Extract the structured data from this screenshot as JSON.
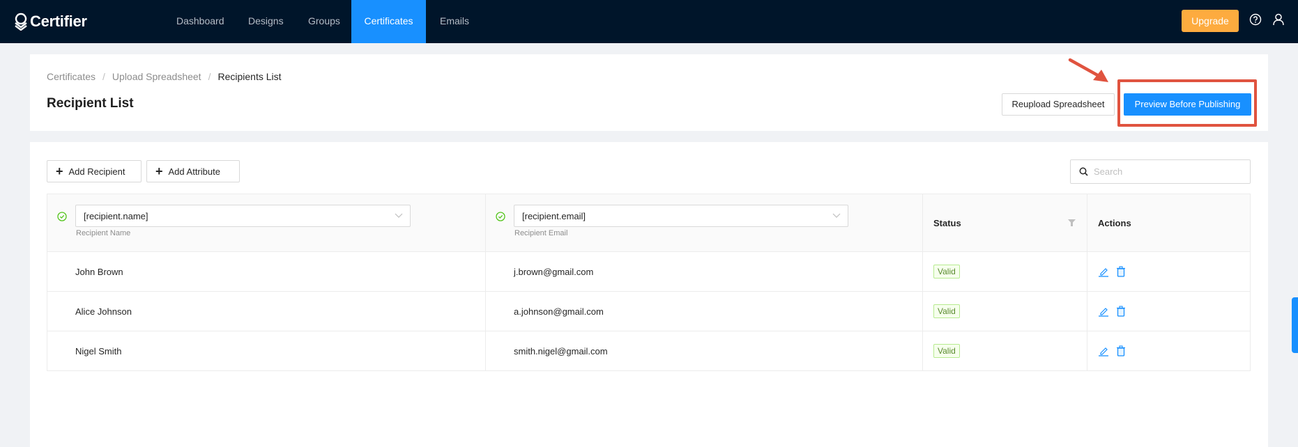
{
  "navbar": {
    "brand": "Certifier",
    "items": [
      {
        "label": "Dashboard",
        "active": false
      },
      {
        "label": "Designs",
        "active": false
      },
      {
        "label": "Groups",
        "active": false
      },
      {
        "label": "Certificates",
        "active": true
      },
      {
        "label": "Emails",
        "active": false
      }
    ],
    "upgrade_label": "Upgrade",
    "icons": [
      "help-icon",
      "user-icon"
    ]
  },
  "header": {
    "breadcrumb": [
      "Certificates",
      "Upload Spreadsheet",
      "Recipients List"
    ],
    "breadcrumb_separator": "/",
    "title": "Recipient List",
    "reupload_label": "Reupload Spreadsheet",
    "preview_label": "Preview Before Publishing"
  },
  "toolbar": {
    "add_recipient_label": "Add Recipient",
    "add_attribute_label": "Add Attribute",
    "search_placeholder": "Search",
    "search_value": ""
  },
  "table": {
    "columns": [
      {
        "mapping": "[recipient.name]",
        "label": "Recipient Name"
      },
      {
        "mapping": "[recipient.email]",
        "label": "Recipient Email"
      },
      {
        "label": "Status"
      },
      {
        "label": "Actions"
      }
    ],
    "rows": [
      {
        "name": "John Brown",
        "email": "j.brown@gmail.com",
        "status": "Valid"
      },
      {
        "name": "Alice Johnson",
        "email": "a.johnson@gmail.com",
        "status": "Valid"
      },
      {
        "name": "Nigel Smith",
        "email": "smith.nigel@gmail.com",
        "status": "Valid"
      }
    ]
  },
  "colors": {
    "navbar_bg": "#00152a",
    "accent": "#1890ff",
    "upgrade": "#fdab3f",
    "annotation": "#e0533f",
    "valid": "#52c41a"
  }
}
